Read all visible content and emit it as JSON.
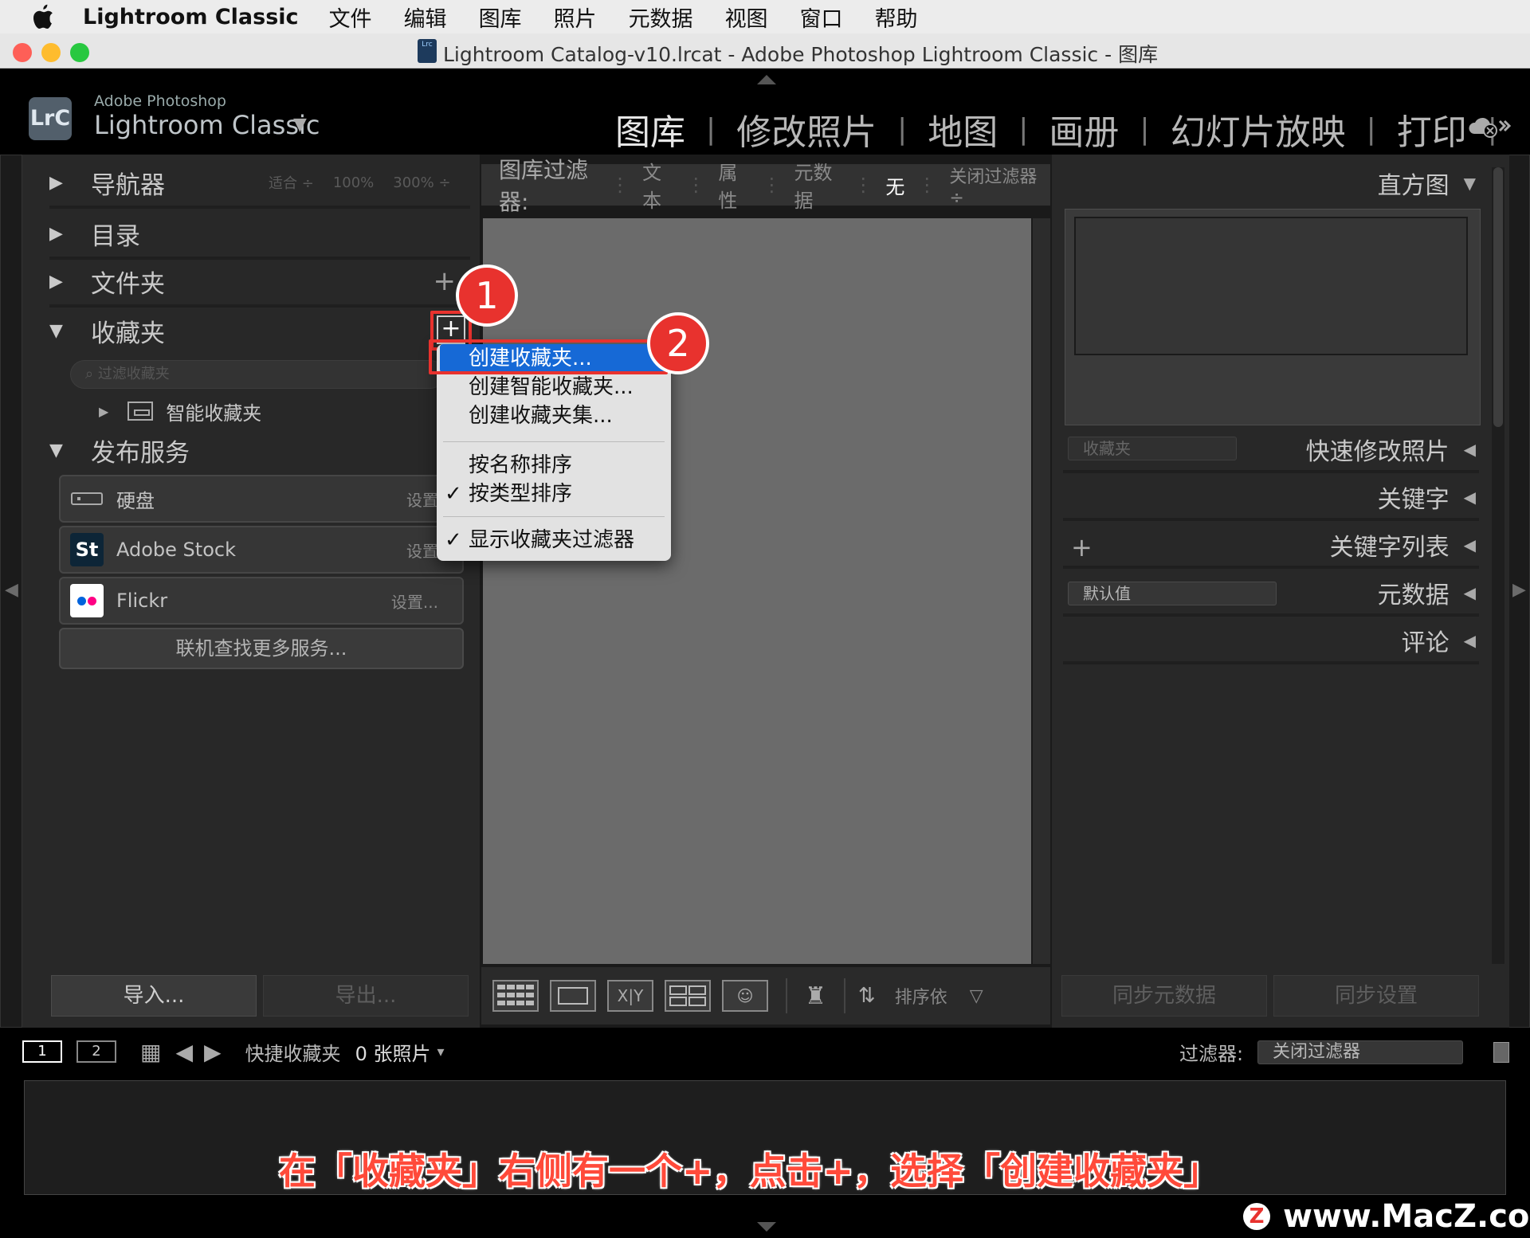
{
  "menubar": {
    "app_name": "Lightroom Classic",
    "items": [
      "文件",
      "编辑",
      "图库",
      "照片",
      "元数据",
      "视图",
      "窗口",
      "帮助"
    ]
  },
  "window": {
    "doc_icon_text": "Lrc",
    "title": "Lightroom Catalog-v10.lrcat - Adobe Photoshop Lightroom Classic - 图库"
  },
  "identity": {
    "logo_text": "LrC",
    "small": "Adobe Photoshop",
    "big": "Lightroom Classic",
    "caret": "▼"
  },
  "modules": [
    "图库",
    "修改照片",
    "地图",
    "画册",
    "幻灯片放映",
    "打印"
  ],
  "left_panel": {
    "navigator": {
      "label": "导航器",
      "zoom_options": [
        "适合 ÷",
        "100%",
        "300% ÷"
      ]
    },
    "catalog": {
      "label": "目录"
    },
    "folders": {
      "label": "文件夹",
      "plus": "+"
    },
    "collections": {
      "label": "收藏夹",
      "search_placeholder": "过滤收藏夹",
      "smart_item": "智能收藏夹"
    },
    "publish": {
      "label": "发布服务",
      "services": [
        {
          "name": "硬盘",
          "setting": "设置"
        },
        {
          "name": "Adobe Stock",
          "setting": "设置",
          "icon_text": "St"
        },
        {
          "name": "Flickr",
          "setting": "设置..."
        }
      ],
      "more_button": "联机查找更多服务..."
    },
    "import_button": "导入...",
    "export_button": "导出..."
  },
  "context_menu": {
    "items": [
      {
        "label": "创建收藏夹...",
        "highlighted": true
      },
      {
        "label": "创建智能收藏夹..."
      },
      {
        "label": "创建收藏夹集..."
      },
      {
        "label": "按名称排序"
      },
      {
        "label": "按类型排序",
        "checked": true
      },
      {
        "label": "显示收藏夹过滤器",
        "checked": true
      }
    ],
    "check_mark": "✓"
  },
  "annotations": {
    "badge1": "1",
    "badge2": "2"
  },
  "center": {
    "filter_title": "图库过滤器:",
    "filters": [
      "文本",
      "属性",
      "元数据",
      "无"
    ],
    "active_filter": "无",
    "close_filter": "关闭过滤器 ÷",
    "sort_label": "排序依"
  },
  "right_panel": {
    "histogram": "直方图",
    "quick_develop_select": "收藏夹",
    "quick_develop": "快速修改照片",
    "keywords": "关键字",
    "keyword_list": "关键字列表",
    "metadata_select": "默认值",
    "metadata": "元数据",
    "comments": "评论",
    "sync_metadata": "同步元数据",
    "sync_settings": "同步设置"
  },
  "filmstrip_bar": {
    "pages": [
      "1",
      "2"
    ],
    "source": "快捷收藏夹",
    "count": "0 张照片",
    "filter_label": "过滤器:",
    "filter_value": "关闭过滤器"
  },
  "caption": "在「收藏夹」右侧有一个+，点击+，选择「创建收藏夹」",
  "watermark": "www.MacZ.com",
  "watermark_logo": "Z",
  "colors": {
    "accent_red": "#e8322e",
    "highlight_blue": "#1669d6"
  }
}
